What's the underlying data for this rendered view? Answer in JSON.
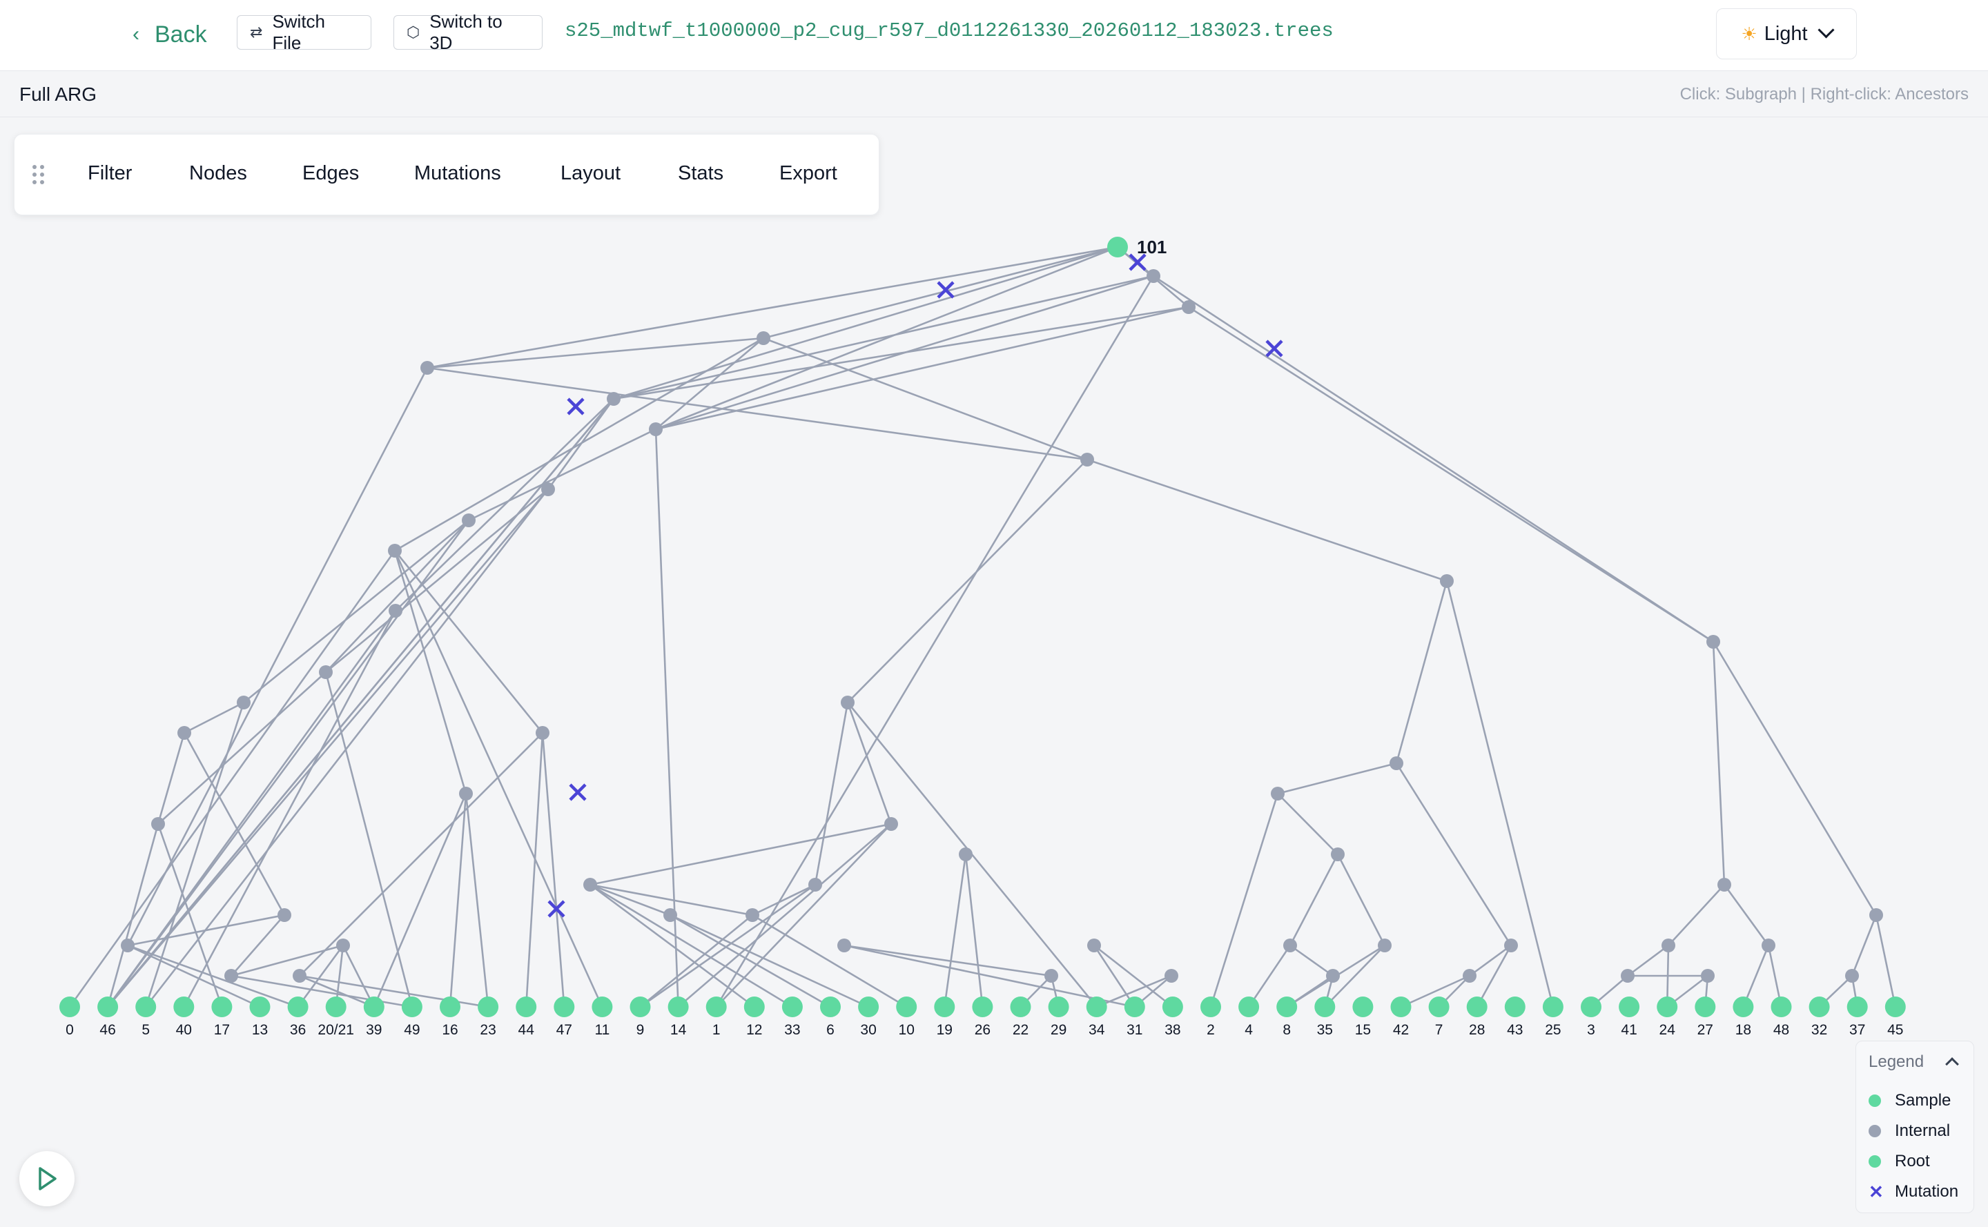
{
  "header": {
    "back_label": "Back",
    "switch_file_label": "Switch File",
    "switch_3d_label": "Switch to 3D",
    "filename": "s25_mdtwf_t1000000_p2_cug_r597_d0112261330_20260112_183023.trees",
    "theme_label": "Light"
  },
  "subheader": {
    "title": "Full ARG",
    "hint": "Click: Subgraph | Right-click: Ancestors"
  },
  "toolbar": {
    "items": [
      "Filter",
      "Nodes",
      "Edges",
      "Mutations",
      "Layout",
      "Stats",
      "Export"
    ]
  },
  "legend": {
    "title": "Legend",
    "items": [
      {
        "label": "Sample",
        "color": "#5fd9a0"
      },
      {
        "label": "Internal",
        "color": "#9aa2b3"
      },
      {
        "label": "Root",
        "color": "#5fd9a0"
      },
      {
        "label": "Mutation",
        "color": "#4b44d6"
      }
    ]
  },
  "graph": {
    "root_label": "101",
    "sample_labels": [
      "0",
      "46",
      "5",
      "40",
      "17",
      "13",
      "36",
      "20/21",
      "39",
      "49",
      "16",
      "23",
      "44",
      "47",
      "11",
      "9",
      "14",
      "1",
      "12",
      "33",
      "6",
      "30",
      "10",
      "19",
      "26",
      "22",
      "29",
      "34",
      "31",
      "38",
      "2",
      "4",
      "8",
      "35",
      "15",
      "42",
      "7",
      "28",
      "43",
      "25",
      "3",
      "41",
      "24",
      "27",
      "18",
      "48",
      "32",
      "37",
      "45"
    ],
    "colors": {
      "sample": "#5fd9a0",
      "internal": "#9aa2b3",
      "edge": "#9aa2b3",
      "mutation": "#4b44d6"
    }
  }
}
